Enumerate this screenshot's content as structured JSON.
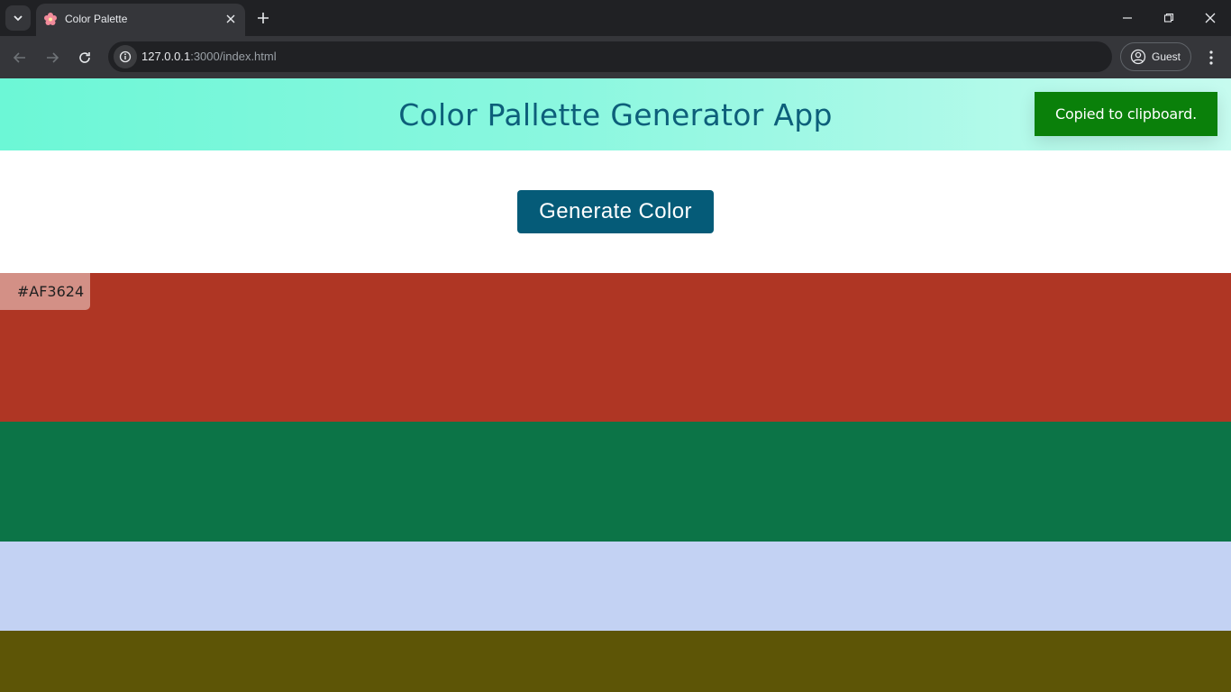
{
  "browser": {
    "tab_title": "Color Palette",
    "url_host": "127.0.0.1",
    "url_path": ":3000/index.html",
    "profile_label": "Guest"
  },
  "page": {
    "title": "Color Pallette Generator App",
    "toast": "Copied to clipboard.",
    "generate_button": "Generate Color"
  },
  "palette": [
    {
      "color": "#af3624",
      "hex_label": "#AF3624"
    },
    {
      "color": "#0c7447"
    },
    {
      "color": "#c3d2f3"
    },
    {
      "color": "#5d5506"
    }
  ],
  "colors": {
    "header_gradient_start": "#6cf7d6",
    "header_gradient_end": "#c6fbef",
    "title": "#0d5f7a",
    "button": "#055b78",
    "toast": "#0a800a"
  }
}
